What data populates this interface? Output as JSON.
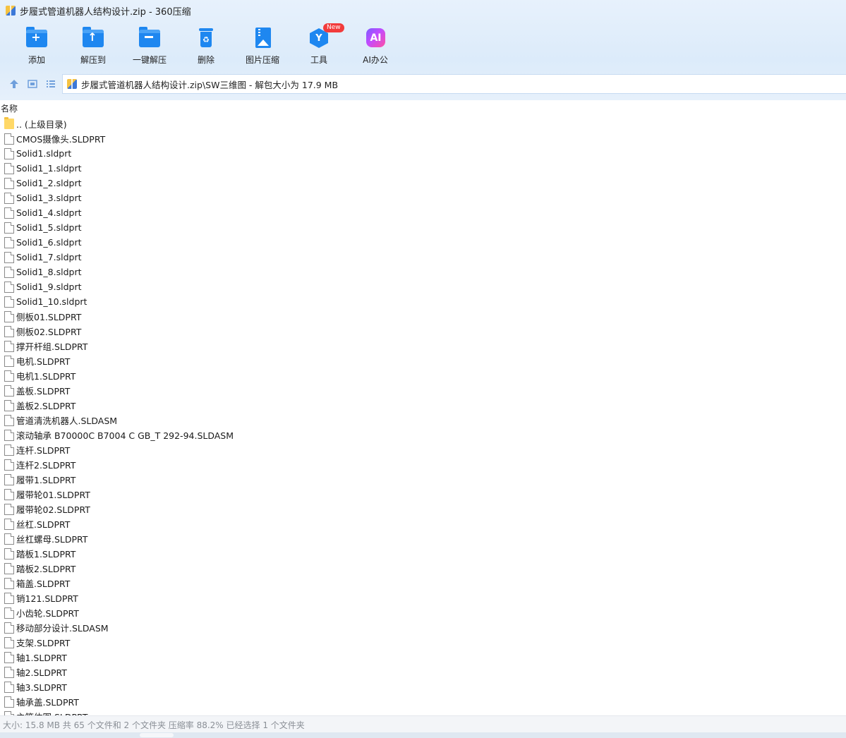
{
  "window": {
    "title": "步履式管道机器人结构设计.zip - 360压缩"
  },
  "toolbar": {
    "items": [
      {
        "label": "添加",
        "icon": "add-folder-icon"
      },
      {
        "label": "解压到",
        "icon": "extract-to-icon"
      },
      {
        "label": "一键解压",
        "icon": "one-click-extract-icon"
      },
      {
        "label": "删除",
        "icon": "delete-trash-icon"
      },
      {
        "label": "图片压缩",
        "icon": "image-compress-icon"
      },
      {
        "label": "工具",
        "icon": "tools-cube-icon",
        "badge": "New"
      },
      {
        "label": "AI办公",
        "icon": "ai-office-icon",
        "glyph": "AI"
      }
    ]
  },
  "address": {
    "path": "步履式管道机器人结构设计.zip\\SW三维图 - 解包大小为 17.9 MB"
  },
  "columns": {
    "name": "名称"
  },
  "files": [
    {
      "name": ".. (上级目录)",
      "type": "folder"
    },
    {
      "name": "CMOS摄像头.SLDPRT",
      "type": "file"
    },
    {
      "name": "Solid1.sldprt",
      "type": "file"
    },
    {
      "name": "Solid1_1.sldprt",
      "type": "file"
    },
    {
      "name": "Solid1_2.sldprt",
      "type": "file"
    },
    {
      "name": "Solid1_3.sldprt",
      "type": "file"
    },
    {
      "name": "Solid1_4.sldprt",
      "type": "file"
    },
    {
      "name": "Solid1_5.sldprt",
      "type": "file"
    },
    {
      "name": "Solid1_6.sldprt",
      "type": "file"
    },
    {
      "name": "Solid1_7.sldprt",
      "type": "file"
    },
    {
      "name": "Solid1_8.sldprt",
      "type": "file"
    },
    {
      "name": "Solid1_9.sldprt",
      "type": "file"
    },
    {
      "name": "Solid1_10.sldprt",
      "type": "file"
    },
    {
      "name": "侧板01.SLDPRT",
      "type": "file"
    },
    {
      "name": "侧板02.SLDPRT",
      "type": "file"
    },
    {
      "name": "撑开杆组.SLDPRT",
      "type": "file"
    },
    {
      "name": "电机.SLDPRT",
      "type": "file"
    },
    {
      "name": "电机1.SLDPRT",
      "type": "file"
    },
    {
      "name": "盖板.SLDPRT",
      "type": "file"
    },
    {
      "name": "盖板2.SLDPRT",
      "type": "file"
    },
    {
      "name": "管道清洗机器人.SLDASM",
      "type": "file"
    },
    {
      "name": "滚动轴承 B70000C B7004 C GB_T 292-94.SLDASM",
      "type": "file"
    },
    {
      "name": "连杆.SLDPRT",
      "type": "file"
    },
    {
      "name": "连杆2.SLDPRT",
      "type": "file"
    },
    {
      "name": "履带1.SLDPRT",
      "type": "file"
    },
    {
      "name": "履带轮01.SLDPRT",
      "type": "file"
    },
    {
      "name": "履带轮02.SLDPRT",
      "type": "file"
    },
    {
      "name": "丝杠.SLDPRT",
      "type": "file"
    },
    {
      "name": "丝杠螺母.SLDPRT",
      "type": "file"
    },
    {
      "name": "踏板1.SLDPRT",
      "type": "file"
    },
    {
      "name": "踏板2.SLDPRT",
      "type": "file"
    },
    {
      "name": "箱盖.SLDPRT",
      "type": "file"
    },
    {
      "name": "销121.SLDPRT",
      "type": "file"
    },
    {
      "name": "小齿轮.SLDPRT",
      "type": "file"
    },
    {
      "name": "移动部分设计.SLDASM",
      "type": "file"
    },
    {
      "name": "支架.SLDPRT",
      "type": "file"
    },
    {
      "name": "轴1.SLDPRT",
      "type": "file"
    },
    {
      "name": "轴2.SLDPRT",
      "type": "file"
    },
    {
      "name": "轴3.SLDPRT",
      "type": "file"
    },
    {
      "name": "轴承盖.SLDPRT",
      "type": "file"
    },
    {
      "name": "主箱体图.SLDPRT",
      "type": "file"
    }
  ],
  "status": {
    "text": "大小: 15.8 MB 共 65 个文件和 2 个文件夹 压缩率 88.2% 已经选择 1 个文件夹"
  },
  "colors": {
    "accent": "#1e87f0",
    "chrome_bg": "#dcebfa",
    "badge": "#f23b3b"
  }
}
